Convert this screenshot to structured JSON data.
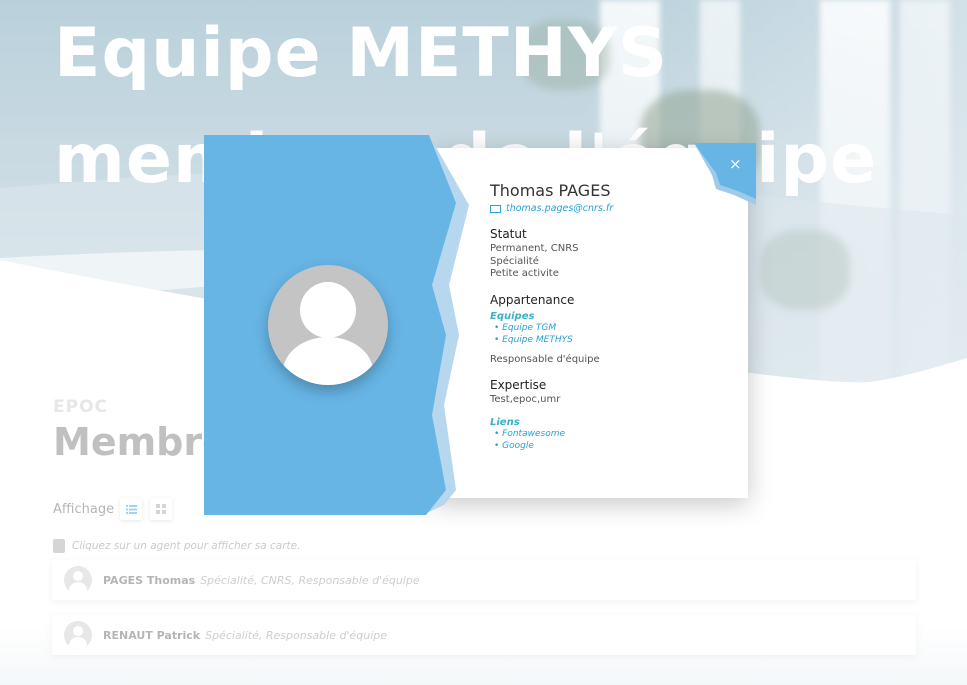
{
  "hero": {
    "title_line1": "Equipe METHYS",
    "title_line2": "membres de l'équipe"
  },
  "section": {
    "kicker": "EPOC",
    "title": "Membres"
  },
  "view": {
    "label": "Affichage",
    "list_icon": "list-icon",
    "grid_icon": "grid-icon",
    "accent": "#6ab7e6"
  },
  "hint": {
    "text": "Cliquez sur un agent pour afficher sa carte."
  },
  "agents": [
    {
      "name": "PAGES Thomas",
      "meta": "Spécialité, CNRS, Responsable d'équipe"
    },
    {
      "name": "RENAUT Patrick",
      "meta": "Spécialité, Responsable d'équipe"
    }
  ],
  "modal": {
    "accent": "#67b5e5",
    "close_label": "×",
    "name": "Thomas PAGES",
    "email": "thomas.pages@cnrs.fr",
    "statut_title": "Statut",
    "statut_lines": [
      "Permanent, CNRS",
      "Spécialité",
      "Petite activite"
    ],
    "appartenance_title": "Appartenance",
    "equipes_title": "Equipes",
    "equipes": [
      "• Equipe TGM",
      "• Equipe METHYS"
    ],
    "role": "Responsable d'équipe",
    "expertise_title": "Expertise",
    "expertise": "Test,epoc,umr",
    "liens_title": "Liens",
    "liens": [
      "• Fontawesome",
      "• Google"
    ]
  }
}
